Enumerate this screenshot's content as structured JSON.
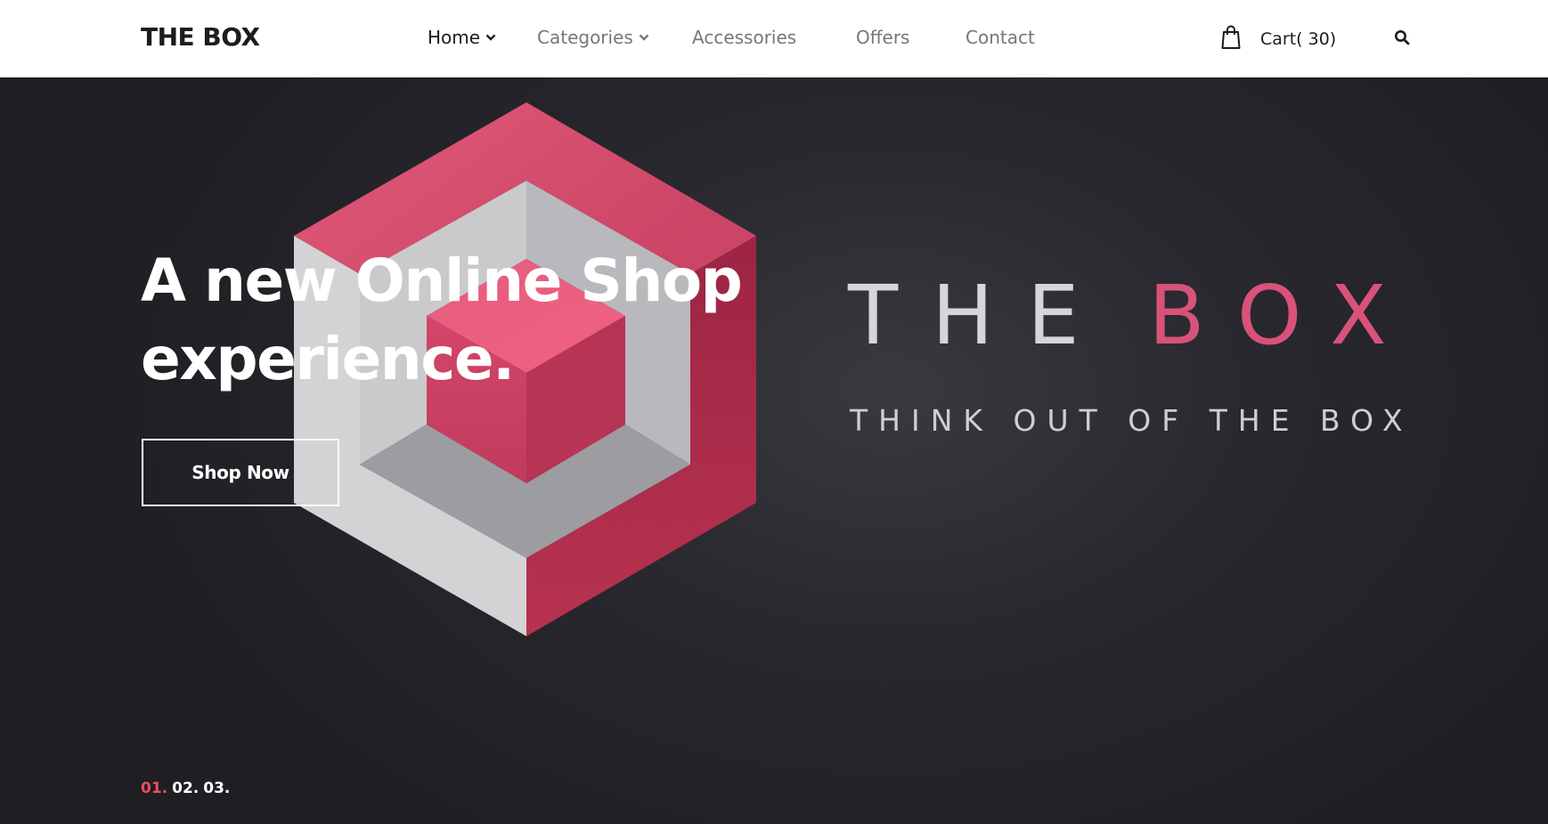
{
  "header": {
    "logo": "THE BOX",
    "nav": [
      {
        "label": "Home",
        "has_dropdown": true,
        "active": true
      },
      {
        "label": "Categories",
        "has_dropdown": true,
        "active": false
      },
      {
        "label": "Accessories",
        "has_dropdown": false,
        "active": false
      },
      {
        "label": "Offers",
        "has_dropdown": false,
        "active": false
      },
      {
        "label": "Contact",
        "has_dropdown": false,
        "active": false
      }
    ],
    "cart_label": "Cart( 30)",
    "cart_icon": "shopping-bag-icon",
    "search_icon": "search-icon"
  },
  "hero": {
    "headline_line1": "A new Online Shop",
    "headline_line2": "experience.",
    "cta_label": "Shop Now",
    "brand_word1": "THE",
    "brand_word2": "BOX",
    "brand_tagline": "THINK OUT OF THE BOX",
    "slides": [
      "01.",
      "02.",
      "03."
    ],
    "active_slide": 0
  },
  "colors": {
    "accent_pink": "#d8527a",
    "slide_active": "#e9505f",
    "hero_background": "#29282e",
    "header_background": "#ffffff",
    "nav_active": "#1c1c1c",
    "nav_inactive": "#777777"
  }
}
